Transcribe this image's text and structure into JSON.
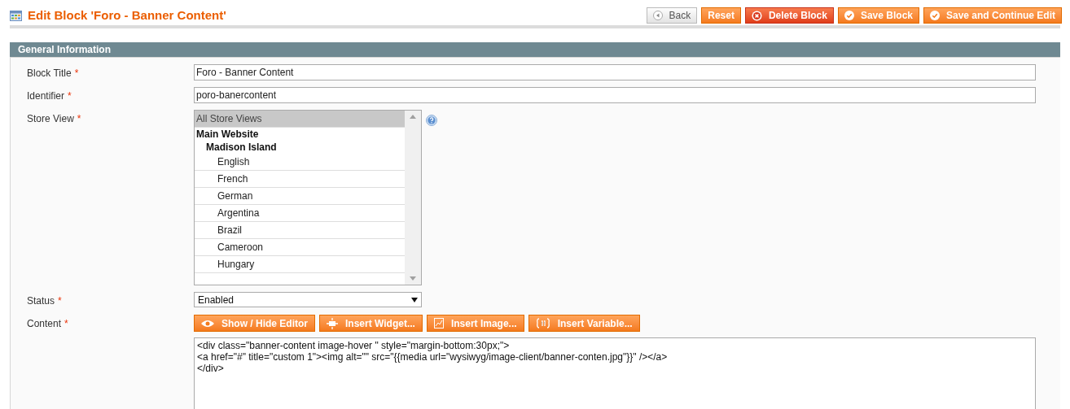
{
  "page_title": "Edit Block 'Foro - Banner Content'",
  "buttons": [
    {
      "label": "Back",
      "kind": "back"
    },
    {
      "label": "Reset",
      "kind": "plain"
    },
    {
      "label": "Delete Block",
      "kind": "delete"
    },
    {
      "label": "Save Block",
      "kind": "save"
    },
    {
      "label": "Save and Continue Edit",
      "kind": "save"
    }
  ],
  "section": {
    "title": "General Information",
    "fields": [
      {
        "label": "Block Title",
        "required_mark": "*",
        "kind": "text",
        "value": "Foro - Banner Content"
      },
      {
        "label": "Identifier",
        "required_mark": "*",
        "kind": "text",
        "value": "poro-banercontent"
      },
      {
        "label": "Store View",
        "required_mark": "*",
        "kind": "multiselect",
        "help": true,
        "options": [
          {
            "label": "All Store Views",
            "selected": true
          },
          {
            "label": "Main Website",
            "group": true,
            "children": [
              {
                "label": "Madison Island",
                "group": true,
                "children": [
                  {
                    "label": "English",
                    "selected": false
                  },
                  {
                    "label": "French",
                    "selected": false
                  },
                  {
                    "label": "German",
                    "selected": false
                  },
                  {
                    "label": "Argentina",
                    "selected": false
                  },
                  {
                    "label": "Brazil",
                    "selected": false
                  },
                  {
                    "label": "Cameroon",
                    "selected": false
                  },
                  {
                    "label": "Hungary",
                    "selected": false
                  }
                ]
              }
            ]
          }
        ]
      },
      {
        "label": "Status",
        "required_mark": "*",
        "kind": "select",
        "value": "Enabled"
      },
      {
        "label": "Content",
        "required_mark": "*",
        "kind": "editor",
        "tools": [
          {
            "label": "Show / Hide Editor",
            "kind": "eye"
          },
          {
            "label": "Insert Widget...",
            "kind": "widget"
          },
          {
            "label": "Insert Image...",
            "kind": "image"
          },
          {
            "label": "Insert Variable...",
            "kind": "variable"
          }
        ],
        "lines": [
          "<div class=\"banner-content image-hover \" style=\"margin-bottom:30px;\">",
          "<a href=\"#\" title=\"custom 1\"><img alt=\"\" src=\"{{media url=\"wysiwyg/image-client/banner-conten.jpg\"}}\" /></a>",
          "</div>"
        ]
      }
    ]
  }
}
